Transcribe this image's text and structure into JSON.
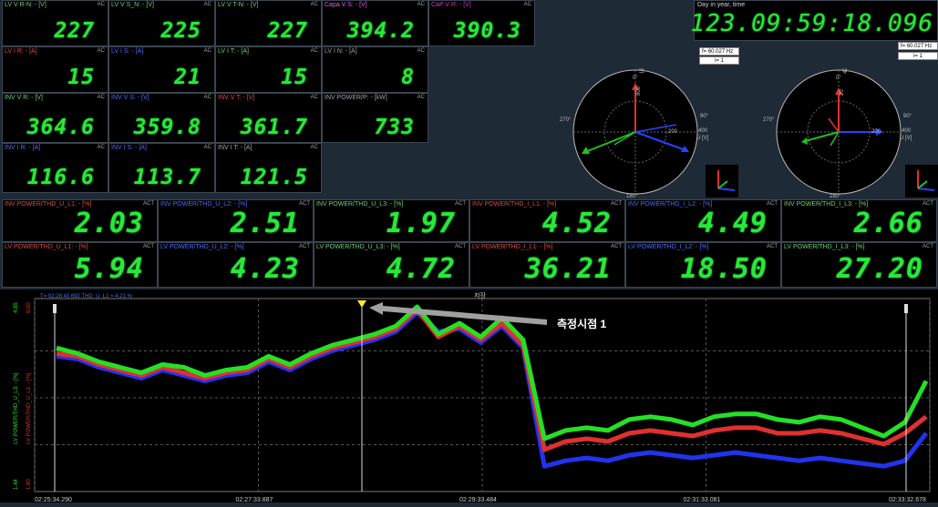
{
  "tiles_row1": [
    {
      "label": "LV V R-N: - [V]",
      "value": "227",
      "color": "lbl-green"
    },
    {
      "label": "LV V S_N: - [V]",
      "value": "225",
      "color": "lbl-green"
    },
    {
      "label": "LV V T-N: - [V]",
      "value": "227",
      "color": "lbl-green"
    },
    {
      "label": "Capa V S: - [V]",
      "value": "394.2",
      "color": "lbl-pink"
    },
    {
      "label": "CaP V R: - [V]",
      "value": "390.3",
      "color": "lbl-mag"
    }
  ],
  "tiles_row2": [
    {
      "label": "LV I R: - [A]",
      "value": "15",
      "color": "lbl-red"
    },
    {
      "label": "LV I S: - [A]",
      "value": "21",
      "color": "lbl-blue"
    },
    {
      "label": "LV I T: - [A]",
      "value": "15",
      "color": "lbl-green"
    },
    {
      "label": "LV I N: - [A]",
      "value": "8",
      "color": "lbl-gray"
    }
  ],
  "tiles_row3": [
    {
      "label": "INV V R: - [V]",
      "value": "364.6",
      "color": "lbl-green"
    },
    {
      "label": "INV V S: - [V]",
      "value": "359.8",
      "color": "lbl-blue"
    },
    {
      "label": "INV V T: - [V]",
      "value": "361.7",
      "color": "lbl-red"
    },
    {
      "label": "INV POWER/P: - [kW]",
      "value": "733",
      "color": "lbl-gray"
    }
  ],
  "tiles_row4": [
    {
      "label": "INV I R: - [A]",
      "value": "116.6",
      "color": "lbl-blue"
    },
    {
      "label": "INV I S: - [A]",
      "value": "113.7",
      "color": "lbl-blue"
    },
    {
      "label": "INV I T: - [A]",
      "value": "121.5",
      "color": "lbl-gray"
    }
  ],
  "thd_row1": [
    {
      "label": "INV POWER/THD_U_L1: - [%]",
      "value": "2.03",
      "color": "lbl-red"
    },
    {
      "label": "INV POWER/THD_U_L2: - [%]",
      "value": "2.51",
      "color": "lbl-blue"
    },
    {
      "label": "INV POWER/THD_U_L3: - [%]",
      "value": "1.97",
      "color": "lbl-green"
    },
    {
      "label": "INV POWER/THD_I_L1: - [%]",
      "value": "4.52",
      "color": "lbl-red"
    },
    {
      "label": "INV POWER/THD_I_L2: - [%]",
      "value": "4.49",
      "color": "lbl-blue"
    },
    {
      "label": "INV POWER/THD_I_L3: - [%]",
      "value": "2.66",
      "color": "lbl-green"
    }
  ],
  "thd_row2": [
    {
      "label": "LV POWER/THD_U_L1: - [%]",
      "value": "5.94",
      "color": "lbl-red"
    },
    {
      "label": "LV POWER/THD_U_L2: - [%]",
      "value": "4.23",
      "color": "lbl-blue"
    },
    {
      "label": "LV POWER/THD_U_L3: - [%]",
      "value": "4.72",
      "color": "lbl-green"
    },
    {
      "label": "LV POWER/THD_I_L1: - [%]",
      "value": "36.21",
      "color": "lbl-red"
    },
    {
      "label": "LV POWER/THD_I_L2: - [%]",
      "value": "18.50",
      "color": "lbl-blue"
    },
    {
      "label": "LV POWER/THD_I_L3: - [%]",
      "value": "27.20",
      "color": "lbl-green"
    }
  ],
  "tile_tag": "AC",
  "thd_tag": "ACT",
  "clock": {
    "label": "Day in year, time",
    "value": "123.09:59:18.096"
  },
  "phasor_left": {
    "freq": "f= 60.027 Hz",
    "i_label": "i= 1",
    "scale_label": "U [V]",
    "tick_a": "200",
    "tick_b": "400",
    "top_a": "800",
    "top_b": "1600",
    "unit_top": "I [A]"
  },
  "phasor_right": {
    "freq": "f= 60.027 Hz",
    "i_label": "i= 1",
    "scale_label": "U [V]",
    "tick_a": "200",
    "tick_b": "400",
    "top_a": "20",
    "top_b": "40",
    "unit_top": "I [A]"
  },
  "angles": {
    "a0": "0°",
    "a90": "90°",
    "a180": "180°",
    "a270": "270°"
  },
  "chart_data": {
    "type": "line",
    "x_ticks": [
      "02:25:34.290",
      "02:27:33.887",
      "02:29:33.484",
      "02:31:33.081",
      "02:33:32.678"
    ],
    "legend_top": "T= 02:28:40.692 THD_U_L1 = 4.21 %",
    "center_title": "저장",
    "annotation": "측정시점 1",
    "yaxis_green_label": "LV POWER/THD_U_L3: - [%]",
    "yaxis_red_label": "LV POWER/THD_U_L1: - [%]",
    "y_top_green": "4.85",
    "y_top_red": "6.00",
    "y_bot_green": "1.44",
    "y_bot_red": "1.80",
    "series": [
      {
        "color": "#25e025",
        "values": [
          4.05,
          3.95,
          3.8,
          3.7,
          3.6,
          3.75,
          3.7,
          3.55,
          3.65,
          3.7,
          3.9,
          3.75,
          3.95,
          4.1,
          4.2,
          4.3,
          4.45,
          4.8,
          4.3,
          4.5,
          4.25,
          4.6,
          4.2,
          2.4,
          2.55,
          2.6,
          2.55,
          2.75,
          2.8,
          2.75,
          2.65,
          2.8,
          2.85,
          2.85,
          2.75,
          2.7,
          2.8,
          2.75,
          2.6,
          2.45,
          2.7,
          3.45
        ]
      },
      {
        "color": "#e03030",
        "values": [
          3.95,
          3.9,
          3.75,
          3.65,
          3.55,
          3.7,
          3.6,
          3.5,
          3.6,
          3.65,
          3.85,
          3.7,
          3.9,
          4.05,
          4.15,
          4.25,
          4.4,
          4.75,
          4.25,
          4.45,
          4.2,
          4.5,
          4.1,
          2.2,
          2.35,
          2.4,
          2.35,
          2.5,
          2.55,
          2.5,
          2.45,
          2.55,
          2.6,
          2.6,
          2.5,
          2.5,
          2.55,
          2.5,
          2.4,
          2.3,
          2.5,
          2.8
        ]
      },
      {
        "color": "#2233ee",
        "values": [
          3.9,
          3.85,
          3.7,
          3.6,
          3.5,
          3.65,
          3.55,
          3.45,
          3.55,
          3.6,
          3.8,
          3.65,
          3.85,
          4.0,
          4.1,
          4.2,
          4.35,
          4.7,
          4.35,
          4.4,
          4.15,
          4.45,
          4.05,
          1.9,
          2.0,
          2.05,
          2.0,
          2.1,
          2.15,
          2.1,
          2.05,
          2.1,
          2.15,
          2.1,
          2.05,
          2.0,
          2.05,
          2.0,
          1.95,
          1.9,
          2.0,
          2.5
        ]
      }
    ]
  }
}
